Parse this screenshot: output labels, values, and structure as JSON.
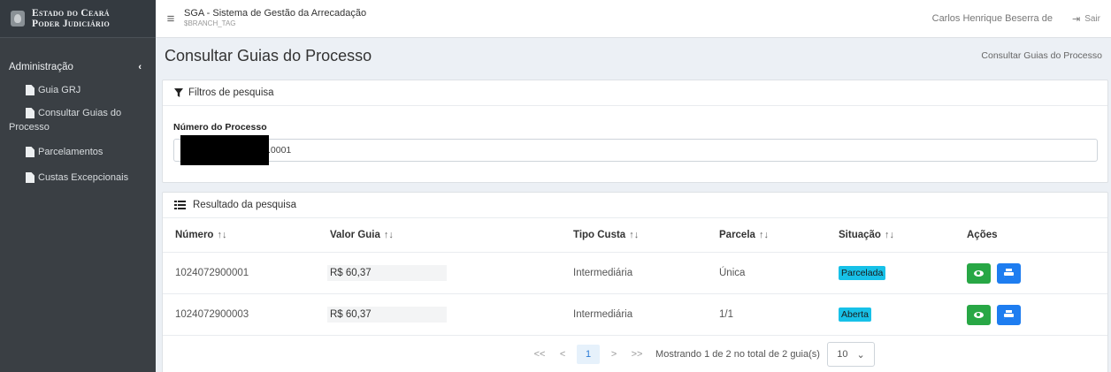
{
  "brand": {
    "line1": "Estado do Ceará",
    "line2": "Poder Judiciário"
  },
  "sidebar": {
    "section": "Administração",
    "items": [
      {
        "label": "Guia GRJ"
      },
      {
        "label": "Consultar Guias do Processo"
      },
      {
        "label": "Parcelamentos"
      },
      {
        "label": "Custas Excepcionais"
      }
    ]
  },
  "topbar": {
    "app_title": "SGA - Sistema de Gestão da Arrecadação",
    "branch_tag": "$BRANCH_TAG",
    "user_name": "Carlos Henrique Beserra de",
    "logout_label": "Sair"
  },
  "page": {
    "title": "Consultar Guias do Processo",
    "breadcrumb": "Consultar Guias do Processo"
  },
  "filters": {
    "header": "Filtros de pesquisa",
    "process_label": "Número do Processo",
    "process_value": ".0001"
  },
  "results": {
    "header": "Resultado da pesquisa",
    "columns": {
      "numero": "Número",
      "valor": "Valor Guia",
      "tipo": "Tipo Custa",
      "parcela": "Parcela",
      "situacao": "Situação",
      "acoes": "Ações"
    },
    "sort_glyph": "↑↓",
    "rows": [
      {
        "numero": "1024072900001",
        "valor": "R$ 60,37",
        "tipo": "Intermediária",
        "parcela": "Única",
        "situacao": "Parcelada"
      },
      {
        "numero": "1024072900003",
        "valor": "R$ 60,37",
        "tipo": "Intermediária",
        "parcela": "1/1",
        "situacao": "Aberta"
      }
    ]
  },
  "pagination": {
    "first": "<<",
    "prev": "<",
    "current": "1",
    "next": ">",
    "last": ">>",
    "summary": "Mostrando 1 de 2 no total de 2 guia(s)",
    "page_size": "10"
  },
  "colors": {
    "sidebar_bg": "#3a3f44",
    "badge": "#17c1e8",
    "view_button": "#28a745",
    "print_button": "#1e7df0"
  },
  "icons": [
    "menu-icon",
    "chevron-left-icon",
    "document-icon",
    "logout-icon",
    "filter-icon",
    "list-icon",
    "eye-icon",
    "print-icon",
    "chevron-down-icon"
  ]
}
